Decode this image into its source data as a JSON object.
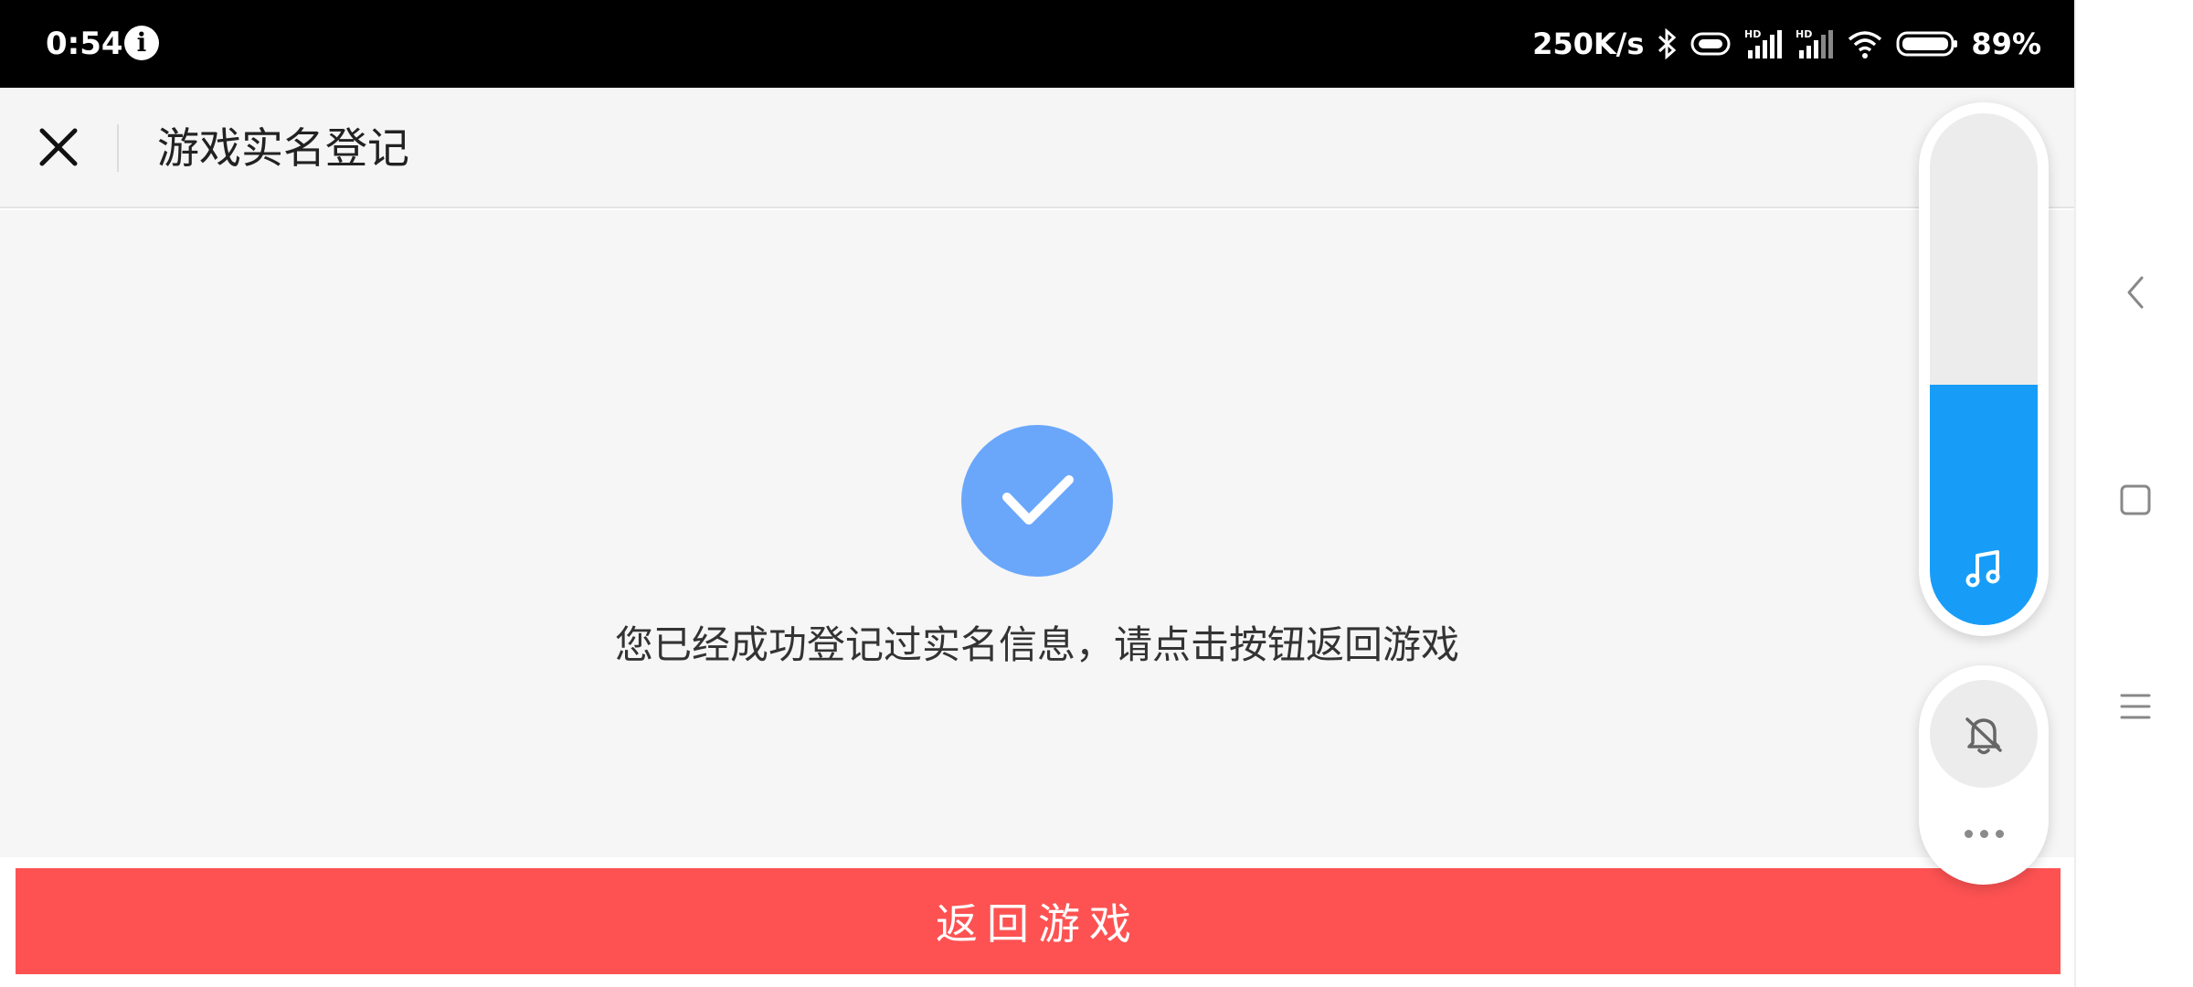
{
  "status_bar": {
    "time": "0:54",
    "info_icon": "info-icon",
    "network_speed": "250K/s",
    "battery_percent": "89%",
    "icons": [
      "bluetooth-icon",
      "vibrate-icon",
      "signal-hd-icon",
      "signal-hd-icon",
      "wifi-icon",
      "battery-icon"
    ]
  },
  "header": {
    "close_icon": "close-icon",
    "title": "游戏实名登记"
  },
  "content": {
    "badge_icon": "checkmark-icon",
    "badge_color": "#6aa7fb",
    "message": "您已经成功登记过实名信息，请点击按钮返回游戏"
  },
  "action": {
    "button_label": "返回游戏",
    "button_color": "#fe5252"
  },
  "volume_overlay": {
    "level": 0.47,
    "fill_color": "#179df7",
    "icon": "music-note-icon",
    "mute_icon": "bell-off-icon",
    "more_icon": "more-dots-icon"
  },
  "nav": {
    "icons": [
      "back-icon",
      "home-icon",
      "recents-icon"
    ]
  }
}
